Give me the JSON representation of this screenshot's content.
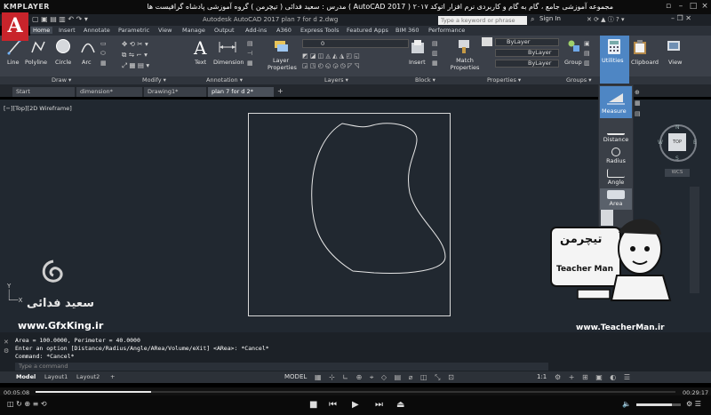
{
  "player": {
    "logo": "KMPLAYER",
    "title": "مجموعه آموزشی جامع ، گام به گام و کاربردی نرم افزار  اتوکد  ۲۰۱۷  ( AutoCAD 2017 )   مدرس : سعید فدائی ( تیچرمن ) گروه آموزشی پادشاه گرافیست ها",
    "time_elapsed": "00:05:08",
    "time_total": "00:29:17",
    "progress_fraction": 0.18
  },
  "acad": {
    "logo": "A",
    "file_title": "Autodesk AutoCAD 2017    plan 7 for d 2.dwg",
    "search_placeholder": "Type a keyword or phrase",
    "sign_in": "Sign In"
  },
  "ribbon_tabs": [
    "Home",
    "Insert",
    "Annotate",
    "Parametric",
    "View",
    "Manage",
    "Output",
    "Add-ins",
    "A360",
    "Express Tools",
    "Featured Apps",
    "BIM 360",
    "Performance"
  ],
  "ribbon": {
    "draw": {
      "label": "Draw ▾",
      "tools": [
        "Line",
        "Polyline",
        "Circle",
        "Arc"
      ]
    },
    "modify": {
      "label": "Modify ▾"
    },
    "annotation": {
      "label": "Annotation ▾",
      "tools": [
        "Text",
        "Dimension"
      ]
    },
    "layers": {
      "label": "Layers ▾",
      "layer_props": "Layer Properties",
      "current_layer": "0"
    },
    "block": {
      "label": "Block ▾",
      "insert": "Insert"
    },
    "properties": {
      "label": "Properties ▾",
      "match": "Match Properties",
      "bylayer": "ByLayer"
    },
    "groups": {
      "label": "Groups ▾",
      "group": "Group"
    },
    "utilities": "Utilities",
    "clipboard": "Clipboard",
    "view": "View"
  },
  "doc_tabs": [
    "Start",
    "dimension*",
    "Drawing1*",
    "plan 7 for d 2*"
  ],
  "viewport_label": "[−][Top][2D Wireframe]",
  "measure_menu": [
    "Measure",
    "Distance",
    "Radius",
    "Angle",
    "Area"
  ],
  "viewcube": {
    "top": "TOP",
    "n": "N",
    "s": "S",
    "e": "E",
    "w": "W",
    "wcs": "WCS"
  },
  "command": {
    "lines": [
      "Area = 100.0000, Perimeter = 40.0000",
      "Enter an option [Distance/Radius/Angle/ARea/Volume/eXit] <ARea>: *Cancel*",
      "Command: *Cancel*"
    ],
    "placeholder": "Type a command"
  },
  "layout_tabs": [
    "Model",
    "Layout1",
    "Layout2",
    "+"
  ],
  "status": {
    "model": "MODEL",
    "scale": "1:1"
  },
  "watermarks": {
    "author": "سعید فدائی",
    "site1": "www.GfxKing.ir",
    "site2": "www.TeacherMan.ir",
    "logo_fa": "تیچرمن",
    "logo_en": "Teacher Man"
  },
  "colors": {
    "accent": "#c8242b",
    "canvas": "#212830",
    "ribbon": "#3b4049"
  }
}
